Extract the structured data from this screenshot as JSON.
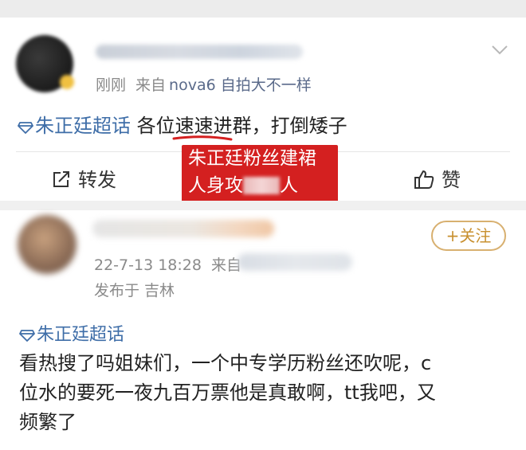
{
  "post1": {
    "meta_time": "刚刚",
    "meta_source_prefix": "来自",
    "meta_device": "nova6 自拍大不一样",
    "topic": "朱正廷超话",
    "content": "各位速速进群，打倒矮子",
    "share_label": "转发",
    "like_label": "赞"
  },
  "overlay": {
    "line1": "朱正廷粉丝建裙",
    "line2_start": "人身攻",
    "line2_end": "人"
  },
  "post2": {
    "follow_label": "+关注",
    "meta_time": "22-7-13 18:28",
    "meta_source_prefix": "来自",
    "location": "发布于 吉林",
    "topic": "朱正廷超话",
    "content_lines": [
      "看热搜了吗姐妹们，一个中专学历粉丝还吹呢，c",
      "位水的要死一夜九百万票他是真敢啊，tt我吧，又",
      "频繁了"
    ]
  },
  "colors": {
    "topic_blue": "#3f6ea8",
    "overlay_red": "#d42020",
    "follow_gold": "#c8902f",
    "meta_gray": "#8a8a8a"
  }
}
